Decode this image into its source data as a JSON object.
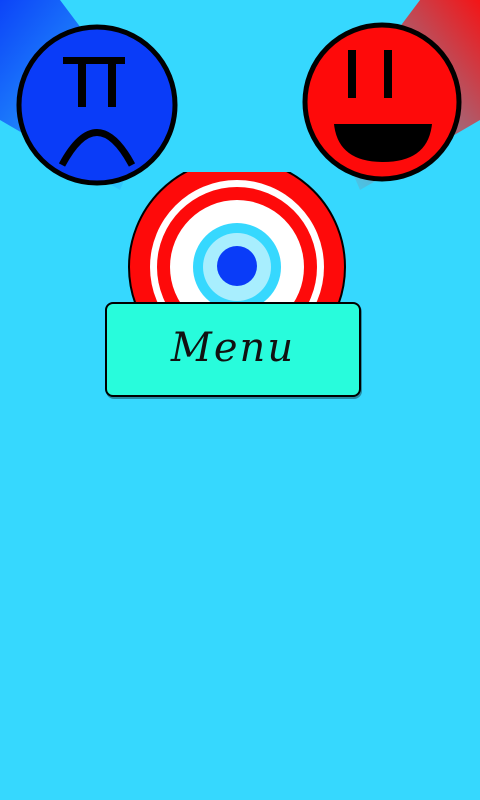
{
  "colors": {
    "background": "#36d8fe",
    "menu_button_fill": "#28fcdc",
    "blue_player": "#0a3cf8",
    "red_player": "#fe0a0a",
    "target_red": "#fe0a0a",
    "target_white": "#ffffff",
    "target_cyan": "#36d8fe",
    "target_blue": "#0a3cf8"
  },
  "players": {
    "blue": {
      "icon": "sad-face-icon"
    },
    "red": {
      "icon": "happy-face-icon"
    }
  },
  "target": {
    "icon": "bullseye-target-icon"
  },
  "menu_button": {
    "label": "Menu"
  }
}
